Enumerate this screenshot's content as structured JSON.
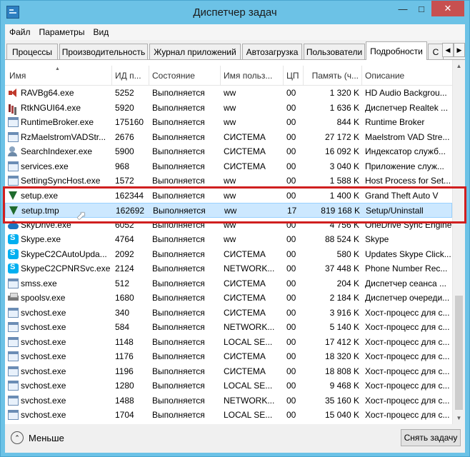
{
  "window": {
    "title": "Диспетчер задач"
  },
  "menu": [
    "Файл",
    "Параметры",
    "Вид"
  ],
  "tabs": [
    {
      "label": "Процессы"
    },
    {
      "label": "Производительность"
    },
    {
      "label": "Журнал приложений"
    },
    {
      "label": "Автозагрузка"
    },
    {
      "label": "Пользователи"
    },
    {
      "label": "Подробности",
      "active": true
    },
    {
      "label": "С"
    }
  ],
  "columns": [
    "Имя",
    "ИД п...",
    "Состояние",
    "Имя польз...",
    "ЦП",
    "Память (ч...",
    "Описание"
  ],
  "rows": [
    {
      "icon": "speaker-icon",
      "name": "RAVBg64.exe",
      "pid": "5252",
      "status": "Выполняется",
      "user": "ww",
      "cpu": "00",
      "mem": "1 320 K",
      "desc": "HD Audio Backgrou..."
    },
    {
      "icon": "equalizer-icon",
      "name": "RtkNGUI64.exe",
      "pid": "5920",
      "status": "Выполняется",
      "user": "ww",
      "cpu": "00",
      "mem": "1 636 K",
      "desc": "Диспетчер Realtek ..."
    },
    {
      "icon": "window-icon",
      "name": "RuntimeBroker.exe",
      "pid": "175160",
      "status": "Выполняется",
      "user": "ww",
      "cpu": "00",
      "mem": "844 K",
      "desc": "Runtime Broker"
    },
    {
      "icon": "window-icon",
      "name": "RzMaelstromVADStr...",
      "pid": "2676",
      "status": "Выполняется",
      "user": "СИСТЕМА",
      "cpu": "00",
      "mem": "27 172 K",
      "desc": "Maelstrom VAD Stre..."
    },
    {
      "icon": "search-person-icon",
      "name": "SearchIndexer.exe",
      "pid": "5900",
      "status": "Выполняется",
      "user": "СИСТЕМА",
      "cpu": "00",
      "mem": "16 092 K",
      "desc": "Индексатор служб..."
    },
    {
      "icon": "window-icon",
      "name": "services.exe",
      "pid": "968",
      "status": "Выполняется",
      "user": "СИСТЕМА",
      "cpu": "00",
      "mem": "3 040 K",
      "desc": "Приложение служ..."
    },
    {
      "icon": "window-icon",
      "name": "SettingSyncHost.exe",
      "pid": "1572",
      "status": "Выполняется",
      "user": "ww",
      "cpu": "00",
      "mem": "1 588 K",
      "desc": "Host Process for Set..."
    },
    {
      "icon": "gta-icon",
      "name": "setup.exe",
      "pid": "162344",
      "status": "Выполняется",
      "user": "ww",
      "cpu": "00",
      "mem": "1 400 K",
      "desc": "Grand Theft Auto V"
    },
    {
      "icon": "gta-icon",
      "name": "setup.tmp",
      "pid": "162692",
      "status": "Выполняется",
      "user": "ww",
      "cpu": "17",
      "mem": "819 168 K",
      "desc": "Setup/Uninstall",
      "selected": true
    },
    {
      "icon": "cloud-icon",
      "name": "SkyDrive.exe",
      "pid": "6052",
      "status": "Выполняется",
      "user": "ww",
      "cpu": "00",
      "mem": "4 756 K",
      "desc": "OneDrive Sync Engine"
    },
    {
      "icon": "skype-icon",
      "name": "Skype.exe",
      "pid": "4764",
      "status": "Выполняется",
      "user": "ww",
      "cpu": "00",
      "mem": "88 524 K",
      "desc": "Skype"
    },
    {
      "icon": "skype-icon",
      "name": "SkypeC2CAutoUpda...",
      "pid": "2092",
      "status": "Выполняется",
      "user": "СИСТЕМА",
      "cpu": "00",
      "mem": "580 K",
      "desc": "Updates Skype Click..."
    },
    {
      "icon": "skype-icon",
      "name": "SkypeC2CPNRSvc.exe",
      "pid": "2124",
      "status": "Выполняется",
      "user": "NETWORK...",
      "cpu": "00",
      "mem": "37 448 K",
      "desc": "Phone Number Rec..."
    },
    {
      "icon": "window-icon",
      "name": "smss.exe",
      "pid": "512",
      "status": "Выполняется",
      "user": "СИСТЕМА",
      "cpu": "00",
      "mem": "204 K",
      "desc": "Диспетчер сеанса ..."
    },
    {
      "icon": "printer-icon",
      "name": "spoolsv.exe",
      "pid": "1680",
      "status": "Выполняется",
      "user": "СИСТЕМА",
      "cpu": "00",
      "mem": "2 184 K",
      "desc": "Диспетчер очереди..."
    },
    {
      "icon": "window-icon",
      "name": "svchost.exe",
      "pid": "340",
      "status": "Выполняется",
      "user": "СИСТЕМА",
      "cpu": "00",
      "mem": "3 916 K",
      "desc": "Хост-процесс для с..."
    },
    {
      "icon": "window-icon",
      "name": "svchost.exe",
      "pid": "584",
      "status": "Выполняется",
      "user": "NETWORK...",
      "cpu": "00",
      "mem": "5 140 K",
      "desc": "Хост-процесс для с..."
    },
    {
      "icon": "window-icon",
      "name": "svchost.exe",
      "pid": "1148",
      "status": "Выполняется",
      "user": "LOCAL SE...",
      "cpu": "00",
      "mem": "17 412 K",
      "desc": "Хост-процесс для с..."
    },
    {
      "icon": "window-icon",
      "name": "svchost.exe",
      "pid": "1176",
      "status": "Выполняется",
      "user": "СИСТЕМА",
      "cpu": "00",
      "mem": "18 320 K",
      "desc": "Хост-процесс для с..."
    },
    {
      "icon": "window-icon",
      "name": "svchost.exe",
      "pid": "1196",
      "status": "Выполняется",
      "user": "СИСТЕМА",
      "cpu": "00",
      "mem": "18 808 K",
      "desc": "Хост-процесс для с..."
    },
    {
      "icon": "window-icon",
      "name": "svchost.exe",
      "pid": "1280",
      "status": "Выполняется",
      "user": "LOCAL SE...",
      "cpu": "00",
      "mem": "9 468 K",
      "desc": "Хост-процесс для с..."
    },
    {
      "icon": "window-icon",
      "name": "svchost.exe",
      "pid": "1488",
      "status": "Выполняется",
      "user": "NETWORK...",
      "cpu": "00",
      "mem": "35 160 K",
      "desc": "Хост-процесс для с..."
    },
    {
      "icon": "window-icon",
      "name": "svchost.exe",
      "pid": "1704",
      "status": "Выполняется",
      "user": "LOCAL SE...",
      "cpu": "00",
      "mem": "15 040 K",
      "desc": "Хост-процесс для с..."
    }
  ],
  "footer": {
    "fewer_label": "Меньше",
    "end_task_label": "Снять задачу"
  },
  "colors": {
    "titlebar": "#6cc2e6",
    "selected_row": "#cce8ff",
    "highlight": "#d01f1f",
    "close_button": "#c75050"
  }
}
